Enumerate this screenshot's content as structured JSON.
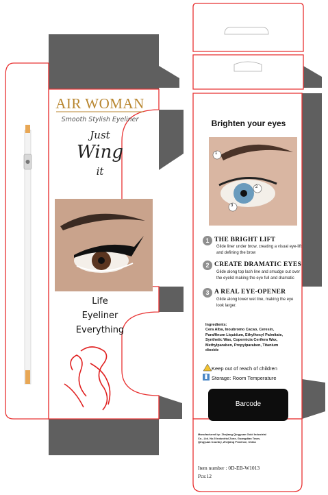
{
  "colors": {
    "cut_line": "#e83030",
    "flap_gray": "#5f5f5f",
    "brand_gold": "#b8862f",
    "pencil": "#e8a755",
    "tattoo_red": "#e02020"
  },
  "front": {
    "brand": "AIR WOMAN",
    "tagline": "Smooth Stylish Eyeliner",
    "headline": {
      "line1": "Just",
      "line2": "Wing",
      "line3": "it"
    },
    "slogan": [
      "Life",
      "Eyeliner",
      "Everything"
    ]
  },
  "side": {
    "title": "Brighten your eyes",
    "photo_markers": [
      "1",
      "2",
      "3"
    ],
    "steps": [
      {
        "num": "1",
        "title": "THE BRIGHT LIFT",
        "desc": "Glide liner under brow, creating a visual eye-lift and defining the brow"
      },
      {
        "num": "2",
        "title": "CREATE DRAMATIC EYES",
        "desc": "Glide along top lash line and smudge out over the eyelid making the eye full and dramatic"
      },
      {
        "num": "3",
        "title": "A REAL EYE-OPENER",
        "desc": "Glide along lower wet line, making the eye look larger."
      }
    ],
    "ingredients_heading": "Ingredients:",
    "ingredients": "Cera Alba, Inoubromo Cacao, Ceresin, Paraffinum Liquidum, Ethylhexyl Palmitate, Synthetic Wax, Copernicia Cerifera Wax, Methylparaben, Propylparaben, Titanium dioxide",
    "warnings": [
      {
        "icon": "warning-triangle-icon",
        "text": "Keep out of reach of children"
      },
      {
        "icon": "thermometer-icon",
        "text": "Storage: Room Temperature"
      }
    ],
    "barcode_label": "Barcode"
  },
  "bottom": {
    "manufacturer": "Manufactured by: Zhejiang Qingyuan Gold Industrial Co., Ltd. No.5 Industrial Zone, Guangdian Town, Qingyuan Country, Zhejiang Province, China",
    "item_number": "Item number : 0D-EB-W1013",
    "pcs": "Pcs:12"
  }
}
